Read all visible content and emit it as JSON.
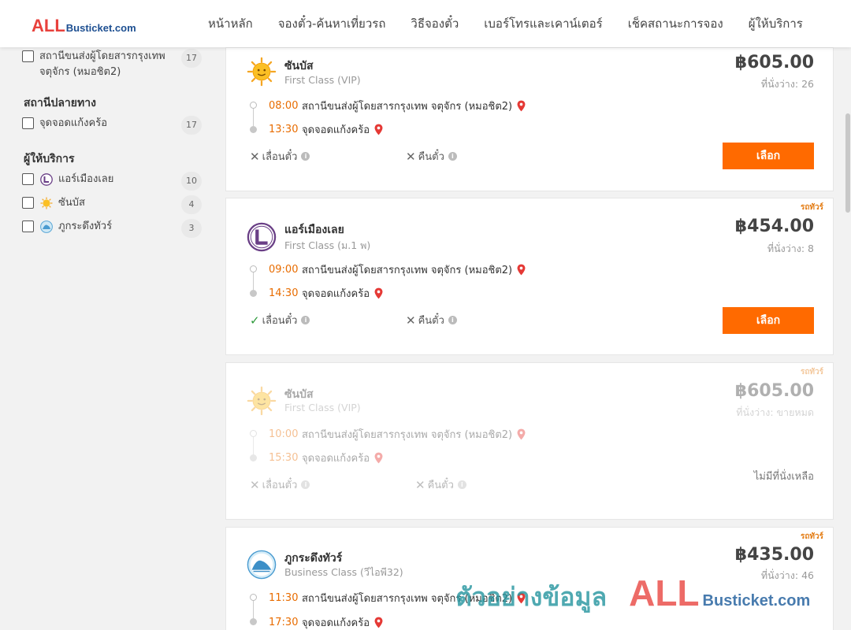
{
  "header": {
    "logo_all": "ALL",
    "logo_rest": "Busticket.com",
    "nav": [
      "หน้าหลัก",
      "จองตั๋ว-ค้นหาเที่ยวรถ",
      "วิธีจองตั๋ว",
      "เบอร์โทรและเคาน์เตอร์",
      "เช็คสถานะการจอง",
      "ผู้ให้บริการ"
    ]
  },
  "sidebar": {
    "origin_item": {
      "label": "สถานีขนส่งผู้โดยสารกรุงเทพ จตุจักร (หมอชิต2)",
      "count": "17"
    },
    "destination_title": "สถานีปลายทาง",
    "destination_item": {
      "label": "จุดจอดแก้งคร้อ",
      "count": "17"
    },
    "operator_title": "ผู้ให้บริการ",
    "operators": [
      {
        "label": "แอร์เมืองเลย",
        "count": "10",
        "icon": "air-muang-loei-logo"
      },
      {
        "label": "ซันบัส",
        "count": "4",
        "icon": "sun-icon"
      },
      {
        "label": "ภูกระดึงทัวร์",
        "count": "3",
        "icon": "phukradueng-logo"
      }
    ]
  },
  "trips": [
    {
      "tag": "",
      "operator": "ซันบัส",
      "class": "First Class (VIP)",
      "price": "฿605.00",
      "seats": "ที่นั่งว่าง: 26",
      "depart_time": "08:00",
      "depart_place": "สถานีขนส่งผู้โดยสารกรุงเทพ จตุจักร (หมอชิต2)",
      "arrive_time": "13:30",
      "arrive_place": "จุดจอดแก้งคร้อ",
      "change_label": "เลื่อนตั๋ว",
      "change_allowed": false,
      "refund_label": "คืนตั๋ว",
      "refund_allowed": false,
      "button": "เลือก"
    },
    {
      "tag": "รถทัวร์",
      "operator": "แอร์เมืองเลย",
      "class": "First Class (ม.1 พ)",
      "price": "฿454.00",
      "seats": "ที่นั่งว่าง: 8",
      "depart_time": "09:00",
      "depart_place": "สถานีขนส่งผู้โดยสารกรุงเทพ จตุจักร (หมอชิต2)",
      "arrive_time": "14:30",
      "arrive_place": "จุดจอดแก้งคร้อ",
      "change_label": "เลื่อนตั๋ว",
      "change_allowed": true,
      "refund_label": "คืนตั๋ว",
      "refund_allowed": false,
      "button": "เลือก"
    },
    {
      "tag": "รถทัวร์",
      "operator": "ซันบัส",
      "class": "First Class (VIP)",
      "price": "฿605.00",
      "seats": "ที่นั่งว่าง: ขายหมด",
      "depart_time": "10:00",
      "depart_place": "สถานีขนส่งผู้โดยสารกรุงเทพ จตุจักร (หมอชิต2)",
      "arrive_time": "15:30",
      "arrive_place": "จุดจอดแก้งคร้อ",
      "change_label": "เลื่อนตั๋ว",
      "change_allowed": false,
      "refund_label": "คืนตั๋ว",
      "refund_allowed": false,
      "soldout_text": "ไม่มีที่นั่งเหลือ"
    },
    {
      "tag": "รถทัวร์",
      "operator": "ภูกระดึงทัวร์",
      "class": "Business Class (วีไอพี32)",
      "price": "฿435.00",
      "seats": "ที่นั่งว่าง: 46",
      "depart_time": "11:30",
      "depart_place": "สถานีขนส่งผู้โดยสารกรุงเทพ จตุจักร (หมอชิต2)",
      "arrive_time": "17:30",
      "arrive_place": "จุดจอดแก้งคร้อ"
    }
  ],
  "watermark": {
    "text": "ตัวอย่างข้อมูล",
    "all": "ALL",
    "rest": "Busticket.com"
  },
  "colors": {
    "accent": "#ff6a00",
    "time": "#e86c00",
    "pin": "#e53935",
    "check": "#2e9a3b",
    "logo_red": "#e8413c",
    "logo_blue": "#1d4f91"
  }
}
